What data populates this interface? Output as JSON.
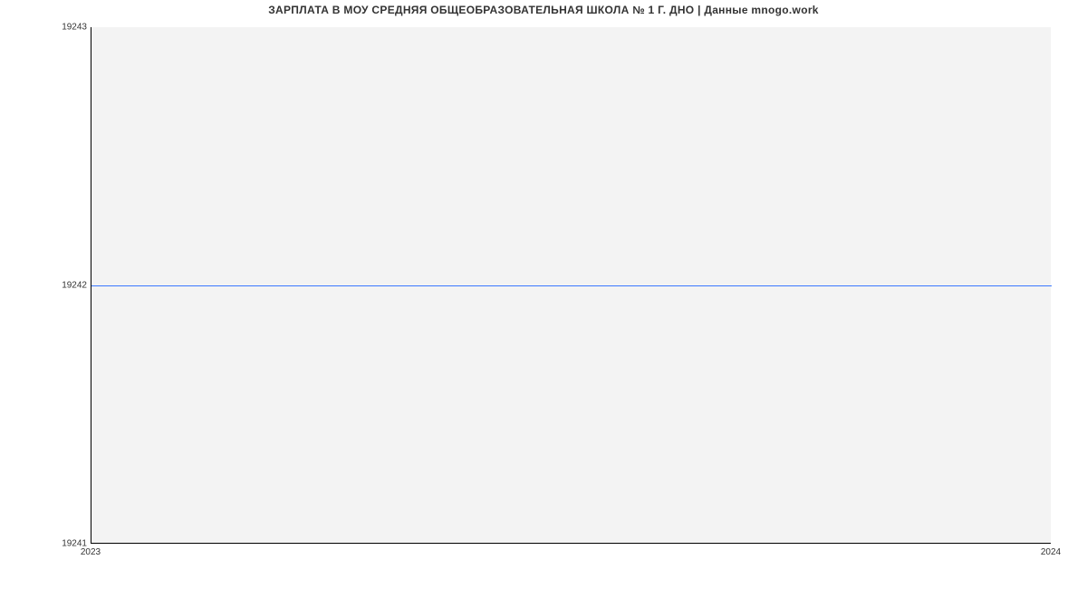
{
  "chart_data": {
    "type": "line",
    "title": "ЗАРПЛАТА В МОУ  СРЕДНЯЯ ОБЩЕОБРАЗОВАТЕЛЬНАЯ ШКОЛА № 1 Г. ДНО | Данные mnogo.work",
    "x": [
      2023,
      2024
    ],
    "values": [
      19242,
      19242
    ],
    "x_ticks": [
      "2023",
      "2024"
    ],
    "y_ticks": [
      "19241",
      "19242",
      "19243"
    ],
    "xlim": [
      2023,
      2024
    ],
    "ylim": [
      19241,
      19243
    ],
    "xlabel": "",
    "ylabel": "",
    "line_color": "#3a78ff",
    "background": "#f3f3f3"
  }
}
